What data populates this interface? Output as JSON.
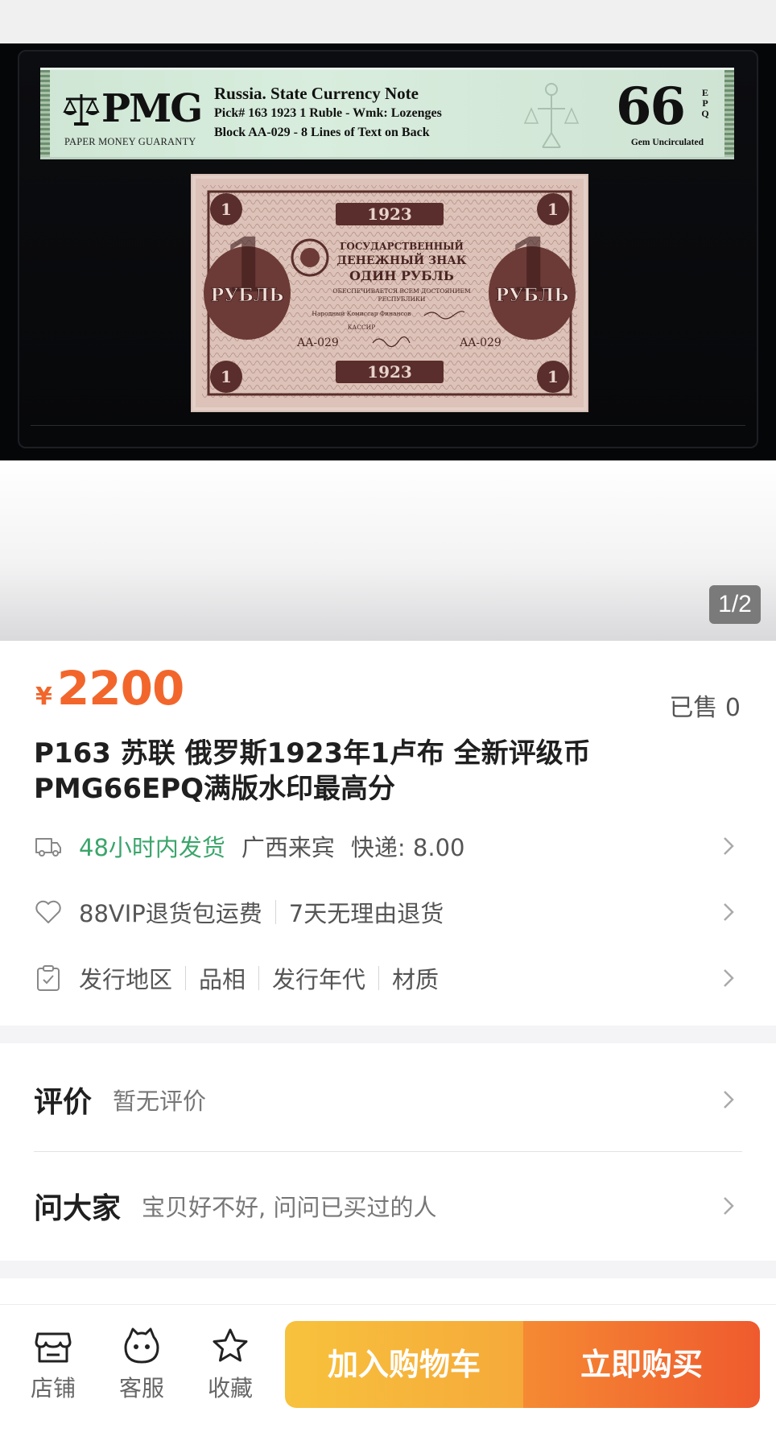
{
  "gallery": {
    "label": {
      "brand": "PMG",
      "brand_sub": "PAPER MONEY GUARANTY",
      "line1": "Russia. State Currency Note",
      "line2": "Pick# 163  1923  1 Ruble - Wmk: Lozenges",
      "line3": "Block AA-029 - 8 Lines of Text on Back",
      "grade": "66",
      "grade_suffix": "EPQ",
      "grade_desc": "Gem Uncirculated"
    },
    "note": {
      "year": "1923",
      "heading1": "ГОСУДАРСТВЕННЫЙ",
      "heading2": "ДЕНЕЖНЫЙ ЗНАК",
      "heading3": "ОДИН РУБЛЬ",
      "small1": "ОБЕСПЕЧИВАЕТСЯ ВСЕМ ДОСТОЯНИЕМ",
      "small2": "РЕСПУБЛИКИ",
      "small3": "Народный Комиссар Финансов",
      "small4": "КАССИР",
      "side_word": "РУБЛЬ",
      "corner_num": "1",
      "serial": "AA-029"
    },
    "page_indicator": "1/2"
  },
  "product": {
    "currency_symbol": "¥",
    "price": "2200",
    "sold": "已售 0",
    "title": "P163 苏联 俄罗斯1923年1卢布 全新评级币 PMG66EPQ满版水印最高分"
  },
  "shipping": {
    "time": "48小时内发货",
    "origin": "广西来宾",
    "fee": "快递: 8.00"
  },
  "service": {
    "item1": "88VIP退货包运费",
    "item2": "7天无理由退货"
  },
  "params": {
    "items": [
      "发行地区",
      "品相",
      "发行年代",
      "材质"
    ]
  },
  "reviews": {
    "title": "评价",
    "subtitle": "暂无评价"
  },
  "ask": {
    "title": "问大家",
    "subtitle": "宝贝好不好, 问问已买过的人"
  },
  "bottombar": {
    "shop": "店铺",
    "service": "客服",
    "favorite": "收藏",
    "add_to_cart": "加入购物车",
    "buy_now": "立即购买"
  },
  "colors": {
    "price": "#f2662c",
    "green": "#3aa56b",
    "cart_button": "#f7c23d",
    "buy_button": "#ef5a2e"
  }
}
